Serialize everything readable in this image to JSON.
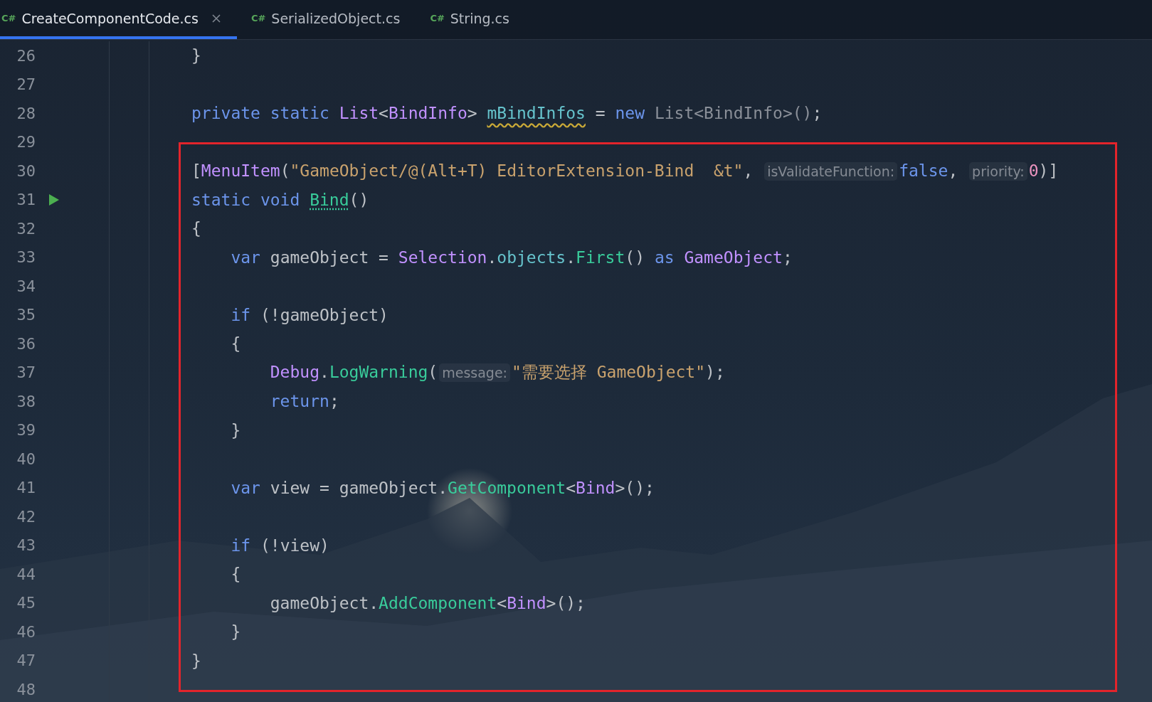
{
  "tabs": [
    {
      "icon_label": "C#",
      "label": "CreateComponentCode.cs",
      "selected": true
    },
    {
      "icon_label": "C#",
      "label": "SerializedObject.cs",
      "selected": false
    },
    {
      "icon_label": "C#",
      "label": "String.cs",
      "selected": false
    }
  ],
  "code_blocks": [
    {
      "kind": "plain",
      "lines": [
        {
          "number": "26",
          "tokens": [
            {
              "t": "}",
              "kind": "plain"
            }
          ]
        },
        {
          "number": "27"
        },
        {
          "number": "28",
          "tokens": [
            {
              "t": "private static ",
              "kind": "keyword"
            },
            {
              "t": "List",
              "kind": "type"
            },
            {
              "t": "<",
              "kind": "plain"
            },
            {
              "t": "BindInfo",
              "kind": "type"
            },
            {
              "t": "> ",
              "kind": "plain"
            },
            {
              "t": "mBindInfos",
              "kind": "warnedfield"
            },
            {
              "t": " = ",
              "kind": "plain"
            },
            {
              "t": "new ",
              "kind": "keyword"
            },
            {
              "t": "List<BindInfo>()",
              "kind": "muted"
            },
            {
              "t": ";",
              "kind": "plain"
            }
          ]
        },
        {
          "number": "29"
        }
      ]
    },
    {
      "kind": "highlighted",
      "lines": [
        {
          "number": "30",
          "tokens": [
            {
              "t": "[",
              "kind": "plain"
            },
            {
              "t": "MenuItem",
              "kind": "type"
            },
            {
              "t": "(",
              "kind": "plain"
            },
            {
              "t": "\"GameObject/@(Alt+T) EditorExtension-Bind  &t\"",
              "kind": "string"
            },
            {
              "t": ", ",
              "kind": "plain"
            },
            {
              "t": "isValidateFunction:",
              "kind": "hint"
            },
            {
              "t": "false",
              "kind": "keyword"
            },
            {
              "t": ", ",
              "kind": "plain"
            },
            {
              "t": "priority:",
              "kind": "hint"
            },
            {
              "t": "0",
              "kind": "number"
            },
            {
              "t": ")]",
              "kind": "plain"
            }
          ]
        },
        {
          "number": "31",
          "gutter": {
            "kind": "run"
          },
          "tokens": [
            {
              "t": "static void ",
              "kind": "keyword"
            },
            {
              "t": "Bind",
              "kind": "declmethod"
            },
            {
              "t": "()",
              "kind": "plain"
            }
          ]
        },
        {
          "number": "32",
          "tokens": [
            {
              "t": "{",
              "kind": "plain"
            }
          ]
        },
        {
          "number": "33",
          "tokens": [
            {
              "t": "    var ",
              "kind": "keyword"
            },
            {
              "t": "gameObject = ",
              "kind": "plain"
            },
            {
              "t": "Selection",
              "kind": "type"
            },
            {
              "t": ".",
              "kind": "plain"
            },
            {
              "t": "objects",
              "kind": "field"
            },
            {
              "t": ".",
              "kind": "plain"
            },
            {
              "t": "First",
              "kind": "method"
            },
            {
              "t": "() ",
              "kind": "plain"
            },
            {
              "t": "as ",
              "kind": "keyword"
            },
            {
              "t": "GameObject",
              "kind": "type"
            },
            {
              "t": ";",
              "kind": "plain"
            }
          ]
        },
        {
          "number": "34"
        },
        {
          "number": "35",
          "tokens": [
            {
              "t": "    if ",
              "kind": "keyword"
            },
            {
              "t": "(!gameObject)",
              "kind": "plain"
            }
          ]
        },
        {
          "number": "36",
          "tokens": [
            {
              "t": "    {",
              "kind": "plain"
            }
          ]
        },
        {
          "number": "37",
          "tokens": [
            {
              "t": "        Debug",
              "kind": "type"
            },
            {
              "t": ".",
              "kind": "plain"
            },
            {
              "t": "LogWarning",
              "kind": "method"
            },
            {
              "t": "(",
              "kind": "plain"
            },
            {
              "t": "message:",
              "kind": "hint"
            },
            {
              "t": "\"需要选择 GameObject\"",
              "kind": "string"
            },
            {
              "t": ");",
              "kind": "plain"
            }
          ]
        },
        {
          "number": "38",
          "tokens": [
            {
              "t": "        return",
              "kind": "keyword"
            },
            {
              "t": ";",
              "kind": "plain"
            }
          ]
        },
        {
          "number": "39",
          "tokens": [
            {
              "t": "    }",
              "kind": "plain"
            }
          ]
        },
        {
          "number": "40"
        },
        {
          "number": "41",
          "tokens": [
            {
              "t": "    var ",
              "kind": "keyword"
            },
            {
              "t": "view = gameObject.",
              "kind": "plain"
            },
            {
              "t": "GetComponent",
              "kind": "method"
            },
            {
              "t": "<",
              "kind": "plain"
            },
            {
              "t": "Bind",
              "kind": "type"
            },
            {
              "t": ">();",
              "kind": "plain"
            }
          ]
        },
        {
          "number": "42"
        },
        {
          "number": "43",
          "tokens": [
            {
              "t": "    if ",
              "kind": "keyword"
            },
            {
              "t": "(!view)",
              "kind": "plain"
            }
          ]
        },
        {
          "number": "44",
          "tokens": [
            {
              "t": "    {",
              "kind": "plain"
            }
          ]
        },
        {
          "number": "45",
          "tokens": [
            {
              "t": "        gameObject.",
              "kind": "plain"
            },
            {
              "t": "AddComponent",
              "kind": "method"
            },
            {
              "t": "<",
              "kind": "plain"
            },
            {
              "t": "Bind",
              "kind": "type"
            },
            {
              "t": ">();",
              "kind": "plain"
            }
          ]
        },
        {
          "number": "46",
          "tokens": [
            {
              "t": "    }",
              "kind": "plain"
            }
          ]
        },
        {
          "number": "47",
          "tokens": [
            {
              "t": "}",
              "kind": "plain"
            }
          ]
        }
      ]
    },
    {
      "kind": "plain",
      "lines": [
        {
          "number": "48"
        }
      ]
    }
  ]
}
